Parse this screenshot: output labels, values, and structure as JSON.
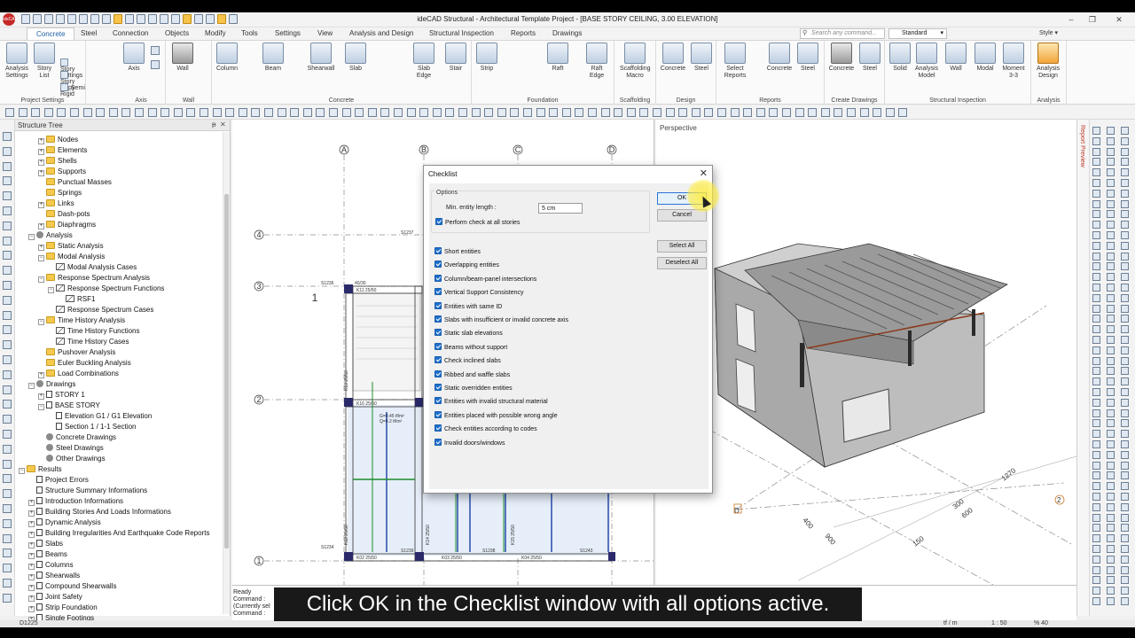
{
  "window": {
    "title": "ideCAD Structural - Architectural Template Project - [BASE STORY CEILING,  3.00 ELEVATION]",
    "logo_text": "ideCAD"
  },
  "ribbon_tabs": [
    "Concrete",
    "Steel",
    "Connection",
    "Objects",
    "Modify",
    "Tools",
    "Settings",
    "View",
    "Analysis and Design",
    "Structural Inspection",
    "Reports",
    "Drawings"
  ],
  "search": {
    "placeholder": "Search any command..."
  },
  "standard_select": "Standard",
  "style_menu": "Style",
  "ribbon": {
    "project_settings": {
      "label": "Project Settings",
      "analysis_settings": "Analysis\nSettings",
      "story_list": "Story\nList",
      "story_settings": "Story Settings",
      "story_copy": "Story Copy",
      "semi_rigid": "Semi Rigid"
    },
    "axis": {
      "label": "Axis",
      "axis_btn": "Axis"
    },
    "wall": {
      "label": "Wall",
      "wall_btn": "Wall"
    },
    "concrete": {
      "label": "Concrete",
      "column": "Column",
      "beam": "Beam",
      "shearwall": "Shearwall",
      "slab": "Slab",
      "slab_edge": "Slab\nEdge",
      "stair": "Stair"
    },
    "foundation": {
      "label": "Foundation",
      "strip": "Strip",
      "raft": "Raft",
      "raft_edge": "Raft\nEdge"
    },
    "scaffolding": {
      "label": "Scaffolding",
      "macro": "Scaffolding\nMacro"
    },
    "design": {
      "label": "Design",
      "concrete": "Concrete",
      "steel": "Steel"
    },
    "reports": {
      "label": "Reports",
      "select_reports": "Select\nReports",
      "concrete": "Concrete",
      "steel": "Steel"
    },
    "create_drawings": {
      "label": "Create Drawings",
      "concrete": "Concrete",
      "steel": "Steel"
    },
    "structural_inspection": {
      "label": "Structural Inspection",
      "solid": "Solid",
      "analysis_model": "Analysis\nModel",
      "wall": "Wall",
      "modal": "Modal",
      "moment": "Moment\n3-3"
    },
    "analysis": {
      "label": "Analysis",
      "design": "Analysis\nDesign"
    }
  },
  "structure_tree": {
    "title": "Structure Tree",
    "pin": "ᵽ",
    "close": "✕",
    "items": [
      {
        "label": "Nodes",
        "level": 3,
        "icon": "folder",
        "exp": "+"
      },
      {
        "label": "Elements",
        "level": 3,
        "icon": "folder",
        "exp": "+"
      },
      {
        "label": "Shells",
        "level": 3,
        "icon": "folder",
        "exp": "+"
      },
      {
        "label": "Supports",
        "level": 3,
        "icon": "folder",
        "exp": "+"
      },
      {
        "label": "Punctual Masses",
        "level": 3,
        "icon": "folder",
        "exp": ""
      },
      {
        "label": "Springs",
        "level": 3,
        "icon": "folder",
        "exp": ""
      },
      {
        "label": "Links",
        "level": 3,
        "icon": "folder",
        "exp": "+"
      },
      {
        "label": "Dash-pots",
        "level": 3,
        "icon": "folder",
        "exp": ""
      },
      {
        "label": "Diaphragms",
        "level": 3,
        "icon": "folder",
        "exp": "+"
      },
      {
        "label": "Analysis",
        "level": 2,
        "icon": "gear",
        "exp": "−"
      },
      {
        "label": "Static Analysis",
        "level": 3,
        "icon": "folder",
        "exp": "+"
      },
      {
        "label": "Modal Analysis",
        "level": 3,
        "icon": "folder",
        "exp": "−"
      },
      {
        "label": "Modal Analysis Cases",
        "level": 4,
        "icon": "chart",
        "exp": ""
      },
      {
        "label": "Response Spectrum Analysis",
        "level": 3,
        "icon": "folder",
        "exp": "−"
      },
      {
        "label": "Response Spectrum Functions",
        "level": 4,
        "icon": "chart",
        "exp": "−"
      },
      {
        "label": "RSF1",
        "level": 5,
        "icon": "chart",
        "exp": ""
      },
      {
        "label": "Response Spectrum Cases",
        "level": 4,
        "icon": "chart",
        "exp": ""
      },
      {
        "label": "Time History Analysis",
        "level": 3,
        "icon": "folder",
        "exp": "−"
      },
      {
        "label": "Time History Functions",
        "level": 4,
        "icon": "chart",
        "exp": ""
      },
      {
        "label": "Time History Cases",
        "level": 4,
        "icon": "chart",
        "exp": ""
      },
      {
        "label": "Pushover Analysis",
        "level": 3,
        "icon": "folder",
        "exp": ""
      },
      {
        "label": "Euler Buckling Analysis",
        "level": 3,
        "icon": "folder",
        "exp": ""
      },
      {
        "label": "Load Combinations",
        "level": 3,
        "icon": "folder",
        "exp": "+"
      },
      {
        "label": "Drawings",
        "level": 2,
        "icon": "gear",
        "exp": "−"
      },
      {
        "label": "STORY 1",
        "level": 3,
        "icon": "doc",
        "exp": "+"
      },
      {
        "label": "BASE STORY",
        "level": 3,
        "icon": "doc",
        "exp": "−"
      },
      {
        "label": "Elevation G1 / G1 Elevation",
        "level": 4,
        "icon": "doc",
        "exp": ""
      },
      {
        "label": "Section 1 / 1-1 Section",
        "level": 4,
        "icon": "doc",
        "exp": ""
      },
      {
        "label": "Concrete Drawings",
        "level": 3,
        "icon": "gear",
        "exp": ""
      },
      {
        "label": "Steel Drawings",
        "level": 3,
        "icon": "gear",
        "exp": ""
      },
      {
        "label": "Other Drawings",
        "level": 3,
        "icon": "gear",
        "exp": ""
      },
      {
        "label": "Results",
        "level": 1,
        "icon": "folder",
        "exp": "−"
      },
      {
        "label": "Project Errors",
        "level": 2,
        "icon": "doc",
        "exp": ""
      },
      {
        "label": "Structure Summary Informations",
        "level": 2,
        "icon": "doc",
        "exp": ""
      },
      {
        "label": "Introduction Informations",
        "level": 2,
        "icon": "doc",
        "exp": "+"
      },
      {
        "label": "Building Stories And Loads Informations",
        "level": 2,
        "icon": "doc",
        "exp": "+"
      },
      {
        "label": "Dynamic Analysis",
        "level": 2,
        "icon": "doc",
        "exp": "+"
      },
      {
        "label": "Building Irregularities And Earthquake Code Reports",
        "level": 2,
        "icon": "doc",
        "exp": "+"
      },
      {
        "label": "Slabs",
        "level": 2,
        "icon": "doc",
        "exp": "+"
      },
      {
        "label": "Beams",
        "level": 2,
        "icon": "doc",
        "exp": "+"
      },
      {
        "label": "Columns",
        "level": 2,
        "icon": "doc",
        "exp": "+"
      },
      {
        "label": "Shearwalls",
        "level": 2,
        "icon": "doc",
        "exp": "+"
      },
      {
        "label": "Compound Shearwalls",
        "level": 2,
        "icon": "doc",
        "exp": "+"
      },
      {
        "label": "Joint Safety",
        "level": 2,
        "icon": "doc",
        "exp": "+"
      },
      {
        "label": "Strip Foundation",
        "level": 2,
        "icon": "doc",
        "exp": "+"
      },
      {
        "label": "Single Footings",
        "level": 2,
        "icon": "doc",
        "exp": "+"
      }
    ]
  },
  "plan_view": {
    "axis_letters": [
      "A",
      "B",
      "C",
      "D"
    ],
    "axis_numbers": [
      "4",
      "3",
      "2",
      "1"
    ],
    "section_mark": "1",
    "labels": {
      "s1237": "S1237",
      "s1236": "S1236",
      "k11": "K11 25/50",
      "k16": "K16 25/50",
      "k02": "K02 25/50",
      "k03": "K03 25/50",
      "k04": "K04 25/50",
      "s1239": "S1239",
      "s1238": "S1238",
      "s1243": "S1243",
      "s1234": "S1234",
      "load_g": "G=0.45 tf/m²",
      "load_q": "Q=0.2 tf/m²",
      "dim_40_30": "40/30",
      "k13": "K13 25/50",
      "k12": "K12 25/50",
      "k14": "K14 25/50",
      "k15": "K15 25/50"
    }
  },
  "perspective_view": {
    "label": "Perspective",
    "dims": [
      "300",
      "600",
      "1270",
      "900",
      "400",
      "150"
    ],
    "axis_d": "D",
    "axis_2": "2"
  },
  "report_preview": "Report Preview",
  "dialog": {
    "title": "Checklist",
    "close": "✕",
    "options_legend": "Options",
    "min_entity_length_label": "Min. entity length :",
    "min_entity_length_value": "5 cm",
    "perform_all_stories": "Perform check at all stories",
    "checks": [
      "Short entities",
      "Overlapping entities",
      "Column/beam-panel intersections",
      "Vertical Support Consistency",
      "Entities with same ID",
      "Slabs with insufficient or invalid concrete axis",
      "Static slab elevations",
      "Beams without support",
      "Check inclined slabs",
      "Ribbed and waffle slabs",
      "Static overridden entities",
      "Entities with invalid structural material",
      "Entities placed with possible wrong angle",
      "Check entities according to codes",
      "Invalid doors/windows"
    ],
    "ok": "OK",
    "cancel": "Cancel",
    "select_all": "Select All",
    "deselect_all": "Deselect All"
  },
  "command_area": {
    "line1": "Ready",
    "line2": "Command :",
    "line3": "(Currently sel",
    "line4": "Command :"
  },
  "status_bar": {
    "left": "D1225",
    "unit": "tf / m",
    "scale": "1 : 50",
    "zoom": "% 40"
  },
  "caption": "Click OK in the Checklist window with all options active.",
  "colors": {
    "accent": "#1e6fcc",
    "highlight": "#ffec3c",
    "caption_bg": "#000000"
  }
}
